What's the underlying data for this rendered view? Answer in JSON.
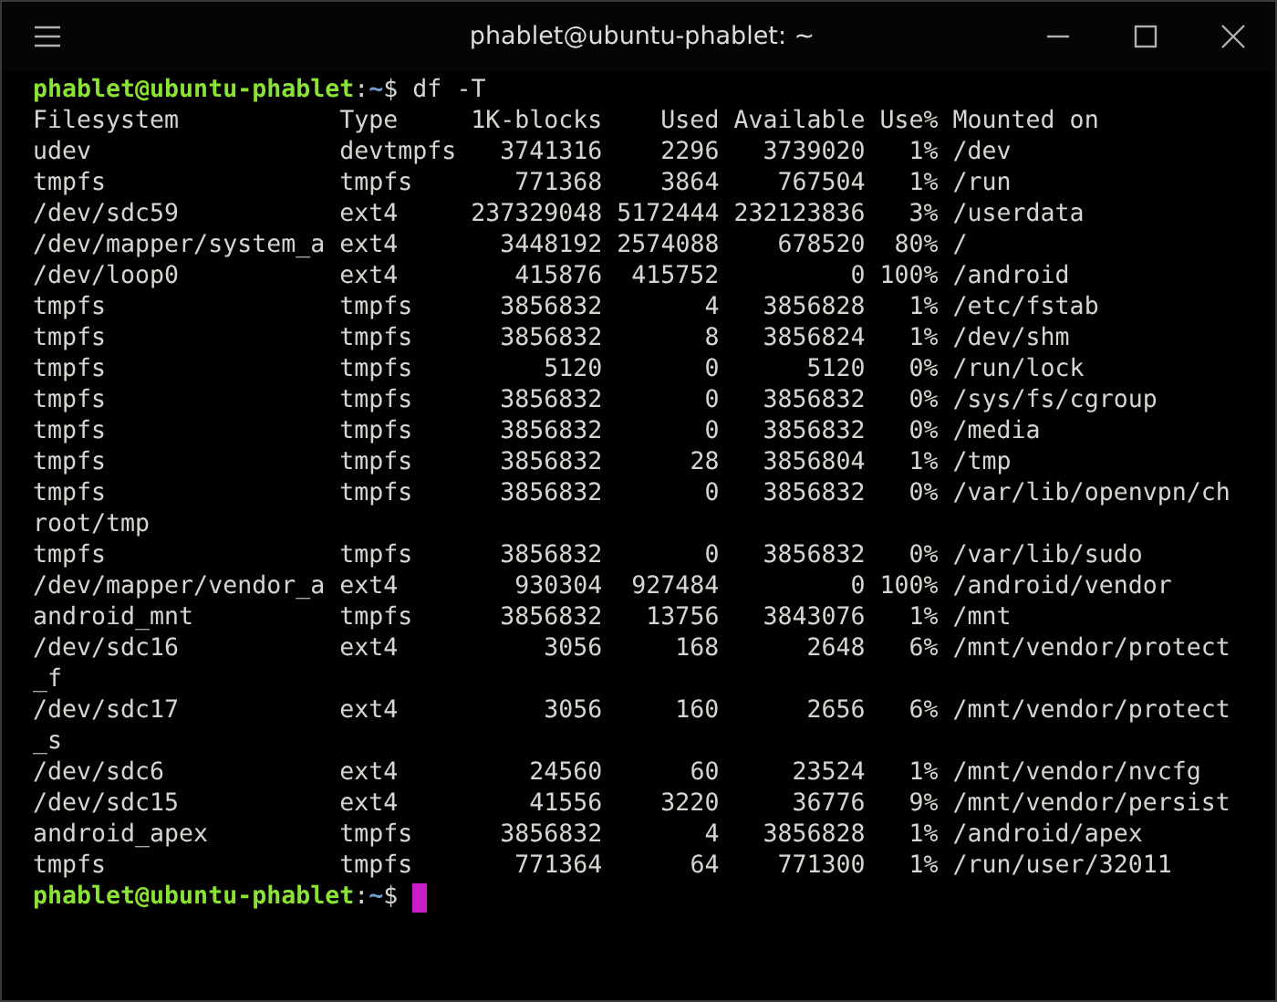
{
  "window": {
    "title": "phablet@ubuntu-phablet: ~"
  },
  "terminal": {
    "command_prompt": {
      "user_host": "phablet@ubuntu-phablet",
      "separator": ":",
      "path": "~",
      "symbol": "$",
      "command": "df -T"
    },
    "table": {
      "columns": [
        "Filesystem",
        "Type",
        "1K-blocks",
        "Used",
        "Available",
        "Use%",
        "Mounted on"
      ],
      "rows": [
        {
          "filesystem": "udev",
          "type": "devtmpfs",
          "blocks": "3741316",
          "used": "2296",
          "available": "3739020",
          "use_pct": "1%",
          "mounted_on": "/dev"
        },
        {
          "filesystem": "tmpfs",
          "type": "tmpfs",
          "blocks": "771368",
          "used": "3864",
          "available": "767504",
          "use_pct": "1%",
          "mounted_on": "/run"
        },
        {
          "filesystem": "/dev/sdc59",
          "type": "ext4",
          "blocks": "237329048",
          "used": "5172444",
          "available": "232123836",
          "use_pct": "3%",
          "mounted_on": "/userdata"
        },
        {
          "filesystem": "/dev/mapper/system_a",
          "type": "ext4",
          "blocks": "3448192",
          "used": "2574088",
          "available": "678520",
          "use_pct": "80%",
          "mounted_on": "/"
        },
        {
          "filesystem": "/dev/loop0",
          "type": "ext4",
          "blocks": "415876",
          "used": "415752",
          "available": "0",
          "use_pct": "100%",
          "mounted_on": "/android"
        },
        {
          "filesystem": "tmpfs",
          "type": "tmpfs",
          "blocks": "3856832",
          "used": "4",
          "available": "3856828",
          "use_pct": "1%",
          "mounted_on": "/etc/fstab"
        },
        {
          "filesystem": "tmpfs",
          "type": "tmpfs",
          "blocks": "3856832",
          "used": "8",
          "available": "3856824",
          "use_pct": "1%",
          "mounted_on": "/dev/shm"
        },
        {
          "filesystem": "tmpfs",
          "type": "tmpfs",
          "blocks": "5120",
          "used": "0",
          "available": "5120",
          "use_pct": "0%",
          "mounted_on": "/run/lock"
        },
        {
          "filesystem": "tmpfs",
          "type": "tmpfs",
          "blocks": "3856832",
          "used": "0",
          "available": "3856832",
          "use_pct": "0%",
          "mounted_on": "/sys/fs/cgroup"
        },
        {
          "filesystem": "tmpfs",
          "type": "tmpfs",
          "blocks": "3856832",
          "used": "0",
          "available": "3856832",
          "use_pct": "0%",
          "mounted_on": "/media"
        },
        {
          "filesystem": "tmpfs",
          "type": "tmpfs",
          "blocks": "3856832",
          "used": "28",
          "available": "3856804",
          "use_pct": "1%",
          "mounted_on": "/tmp"
        },
        {
          "filesystem": "tmpfs",
          "type": "tmpfs",
          "blocks": "3856832",
          "used": "0",
          "available": "3856832",
          "use_pct": "0%",
          "mounted_on": "/var/lib/openvpn/ch",
          "continuation": "root/tmp"
        },
        {
          "filesystem": "tmpfs",
          "type": "tmpfs",
          "blocks": "3856832",
          "used": "0",
          "available": "3856832",
          "use_pct": "0%",
          "mounted_on": "/var/lib/sudo"
        },
        {
          "filesystem": "/dev/mapper/vendor_a",
          "type": "ext4",
          "blocks": "930304",
          "used": "927484",
          "available": "0",
          "use_pct": "100%",
          "mounted_on": "/android/vendor"
        },
        {
          "filesystem": "android_mnt",
          "type": "tmpfs",
          "blocks": "3856832",
          "used": "13756",
          "available": "3843076",
          "use_pct": "1%",
          "mounted_on": "/mnt"
        },
        {
          "filesystem": "/dev/sdc16",
          "type": "ext4",
          "blocks": "3056",
          "used": "168",
          "available": "2648",
          "use_pct": "6%",
          "mounted_on": "/mnt/vendor/protect",
          "continuation": "_f"
        },
        {
          "filesystem": "/dev/sdc17",
          "type": "ext4",
          "blocks": "3056",
          "used": "160",
          "available": "2656",
          "use_pct": "6%",
          "mounted_on": "/mnt/vendor/protect",
          "continuation": "_s"
        },
        {
          "filesystem": "/dev/sdc6",
          "type": "ext4",
          "blocks": "24560",
          "used": "60",
          "available": "23524",
          "use_pct": "1%",
          "mounted_on": "/mnt/vendor/nvcfg"
        },
        {
          "filesystem": "/dev/sdc15",
          "type": "ext4",
          "blocks": "41556",
          "used": "3220",
          "available": "36776",
          "use_pct": "9%",
          "mounted_on": "/mnt/vendor/persist"
        },
        {
          "filesystem": "android_apex",
          "type": "tmpfs",
          "blocks": "3856832",
          "used": "4",
          "available": "3856828",
          "use_pct": "1%",
          "mounted_on": "/android/apex"
        },
        {
          "filesystem": "tmpfs",
          "type": "tmpfs",
          "blocks": "771364",
          "used": "64",
          "available": "771300",
          "use_pct": "1%",
          "mounted_on": "/run/user/32011"
        }
      ]
    },
    "current_prompt": {
      "user_host": "phablet@ubuntu-phablet",
      "separator": ":",
      "path": "~",
      "symbol": "$"
    }
  }
}
